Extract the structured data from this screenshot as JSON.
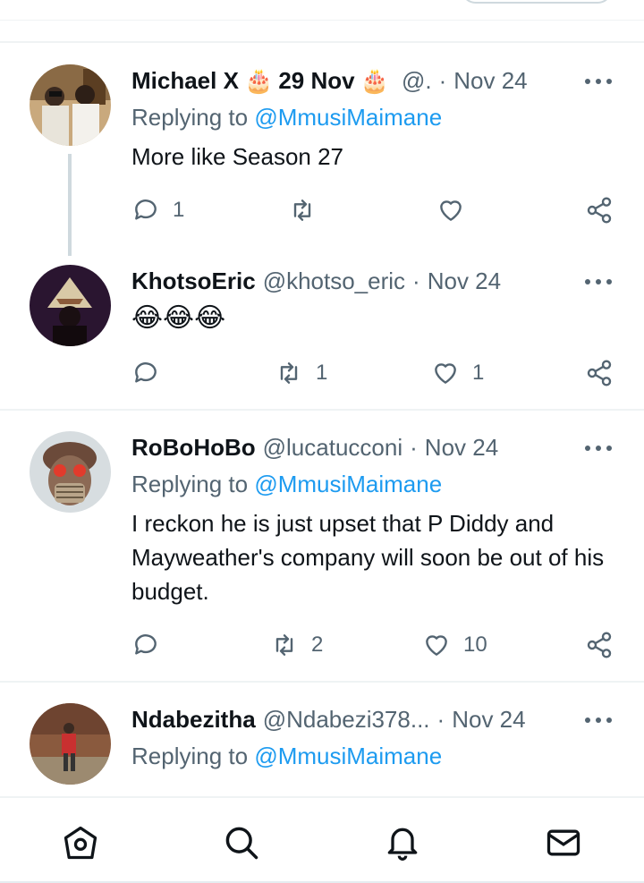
{
  "colors": {
    "accent": "#1d9bf0",
    "muted": "#536471",
    "text": "#0f1419",
    "divider": "#eff3f4"
  },
  "tweets": [
    {
      "name": "Michael X",
      "name_extra": "29 Nov",
      "handle": "@.",
      "time": "Nov 24",
      "reply_prefix": "Replying to",
      "reply_to": "@MmusiMaimane",
      "text": "More like Season 27",
      "replies": "1",
      "retweets": "",
      "likes": ""
    },
    {
      "name": "KhotsoEric",
      "handle": "@khotso_eric",
      "time": "Nov 24",
      "text": "😂😂😂",
      "replies": "",
      "retweets": "1",
      "likes": "1"
    },
    {
      "name": "RoBoHoBo",
      "handle": "@lucatucconi",
      "time": "Nov 24",
      "reply_prefix": "Replying to",
      "reply_to": "@MmusiMaimane",
      "text": "I reckon he is just upset that P Diddy and Mayweather's company will soon be out of his budget.",
      "replies": "",
      "retweets": "2",
      "likes": "10"
    },
    {
      "name": "Ndabezitha",
      "handle": "@Ndabezi378...",
      "time": "Nov 24",
      "reply_prefix": "Replying to",
      "reply_to": "@MmusiMaimane"
    }
  ],
  "icons": {
    "reply": "reply-icon",
    "retweet": "retweet-icon",
    "like": "heart-icon",
    "share": "share-icon",
    "more": "more-icon",
    "birthday": "birthday-cake-icon"
  },
  "nav": [
    "home-icon",
    "search-icon",
    "notifications-icon",
    "messages-icon"
  ]
}
